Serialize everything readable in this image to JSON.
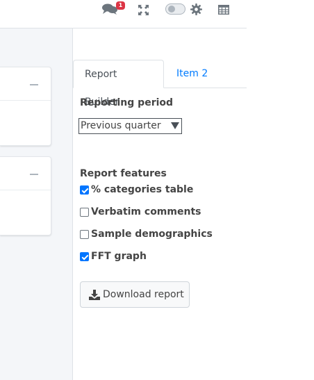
{
  "topbar": {
    "chat_badge_count": "1"
  },
  "tabs": {
    "active_label": "Report Builder",
    "inactive_label": "Item 2"
  },
  "form": {
    "period_label": "Reporting period",
    "period_selected": "Previous quarter",
    "features_label": "Report features",
    "features": [
      {
        "label": "% categories table",
        "checked": true
      },
      {
        "label": "Verbatim comments",
        "checked": false
      },
      {
        "label": "Sample demographics",
        "checked": false
      },
      {
        "label": "FFT graph",
        "checked": true
      }
    ],
    "download_label": "Download report"
  },
  "colors": {
    "accent": "#007bff",
    "badge": "#dc3545",
    "checkbox_checked": "#0075ff"
  }
}
